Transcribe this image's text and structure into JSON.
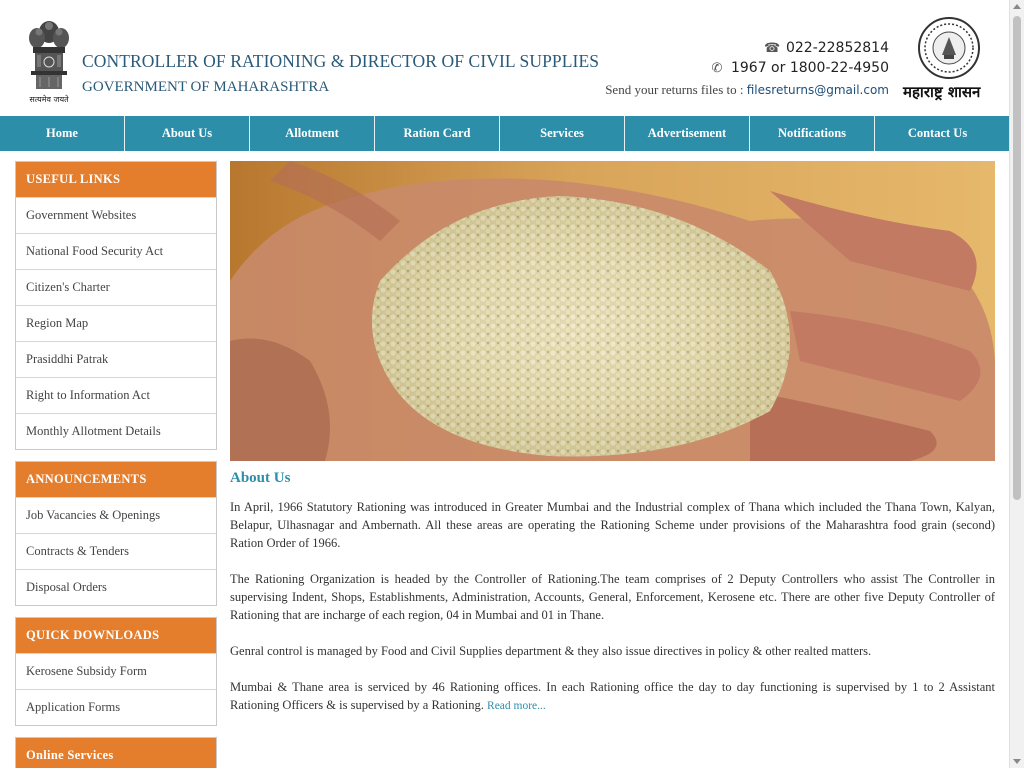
{
  "header": {
    "title": "CONTROLLER OF RATIONING & DIRECTOR OF CIVIL SUPPLIES",
    "subtitle": "GOVERNMENT OF MAHARASHTRA",
    "emblem_caption": "सत्यमेव जयते",
    "phone1": "022-22852814",
    "phone2": "1967 or 1800-22-4950",
    "returns_label": "Send your returns files to",
    "returns_sep": " : ",
    "returns_email": "filesreturns@gmail.com",
    "seal_label": "महाराष्ट्र शासन"
  },
  "nav": [
    "Home",
    "About Us",
    "Allotment",
    "Ration Card",
    "Services",
    "Advertisement",
    "Notifications",
    "Contact Us"
  ],
  "sidebar": {
    "useful_links": {
      "title": "USEFUL LINKS",
      "items": [
        "Government Websites",
        "National Food Security Act",
        "Citizen's Charter",
        "Region Map",
        "Prasiddhi Patrak",
        "Right to Information Act",
        "Monthly Allotment Details"
      ]
    },
    "announcements": {
      "title": "ANNOUNCEMENTS",
      "items": [
        "Job Vacancies & Openings",
        "Contracts & Tenders",
        "Disposal Orders"
      ]
    },
    "quick_downloads": {
      "title": "QUICK DOWNLOADS",
      "items": [
        "Kerosene Subsidy Form",
        "Application Forms"
      ]
    },
    "online_services": {
      "title": "Online Services"
    }
  },
  "main": {
    "about_title": "About Us",
    "paragraphs": [
      "In April, 1966 Statutory Rationing was introduced in Greater Mumbai and the Industrial complex of Thana which included the Thana Town, Kalyan, Belapur, Ulhasnagar and Ambernath. All these areas are operating the Rationing Scheme under provisions of the Maharashtra food grain (second) Ration Order of 1966.",
      "The Rationing Organization is headed by the Controller of Rationing.The team comprises of 2 Deputy Controllers who assist The Controller in supervising Indent, Shops, Establishments, Administration, Accounts, General, Enforcement, Kerosene etc. There are other five Deputy Controller of Rationing that are incharge of each region, 04 in Mumbai and 01 in Thane.",
      "Genral control is managed by Food and Civil Supplies department & they also issue directives in policy & other realted matters."
    ],
    "last_paragraph": "Mumbai & Thane area is serviced by 46 Rationing offices. In each Rationing office the day to day functioning is supervised by 1 to 2 Assistant Rationing Officers & is supervised by a Rationing.",
    "read_more": "Read more..."
  },
  "colors": {
    "nav": "#2d8eaa",
    "sidebar_header": "#e47d2c",
    "title_text": "#2a5a7a",
    "link": "#2d8eaa"
  },
  "icons": {
    "phone1": "telephone-icon",
    "phone2": "handset-icon"
  }
}
